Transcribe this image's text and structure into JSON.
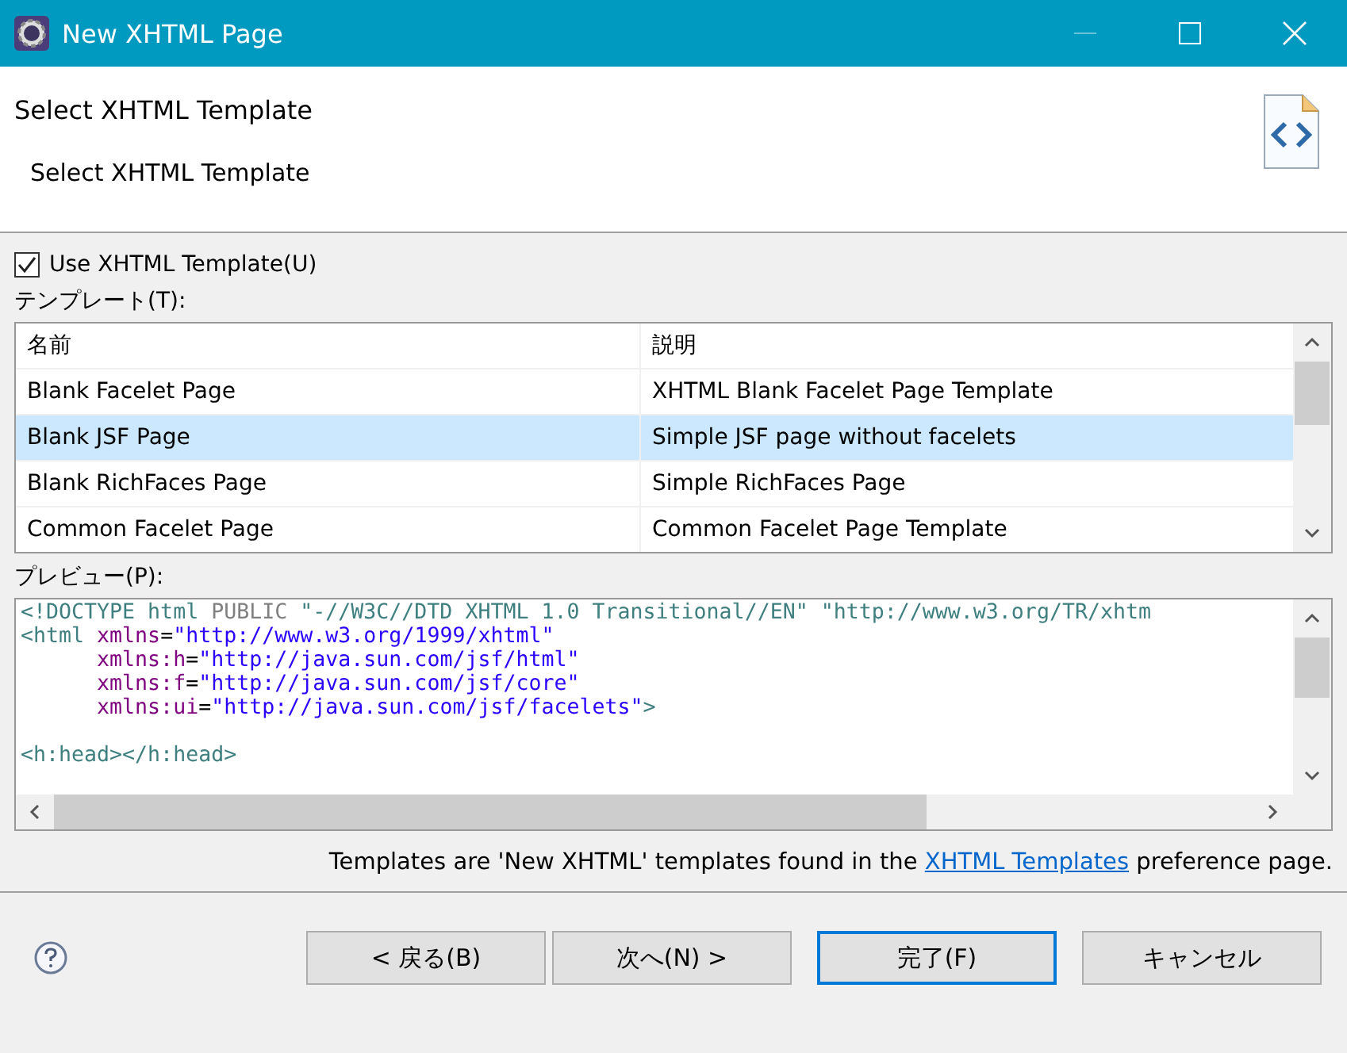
{
  "window": {
    "title": "New XHTML Page",
    "minimize_disabled": true
  },
  "header": {
    "title": "Select XHTML Template",
    "description": "Select XHTML Template"
  },
  "use_template": {
    "label": "Use XHTML Template(U)",
    "checked": true
  },
  "templates": {
    "label": "テンプレート(T):",
    "columns": [
      "名前",
      "説明"
    ],
    "rows": [
      {
        "name": "Blank Facelet Page",
        "description": "XHTML Blank Facelet Page Template",
        "selected": false
      },
      {
        "name": "Blank JSF Page",
        "description": "Simple JSF page without facelets",
        "selected": true
      },
      {
        "name": "Blank RichFaces Page",
        "description": "Simple RichFaces Page",
        "selected": false
      },
      {
        "name": "Common Facelet Page",
        "description": "Common Facelet Page Template",
        "selected": false
      }
    ]
  },
  "preview": {
    "label": "プレビュー(P):",
    "lines": [
      [
        {
          "kind": "tag",
          "text": "<!DOCTYPE html"
        },
        {
          "kind": "keyword",
          "text": " PUBLIC "
        },
        {
          "kind": "tag",
          "text": "\"-//W3C//DTD XHTML 1.0 Transitional//EN\" \"http://www.w3.org/TR/xhtm"
        }
      ],
      [
        {
          "kind": "tag",
          "text": "<html"
        },
        {
          "kind": "attr",
          "text": " xmlns"
        },
        {
          "kind": "plain",
          "text": "="
        },
        {
          "kind": "value",
          "text": "\"http://www.w3.org/1999/xhtml\""
        }
      ],
      [
        {
          "kind": "attr",
          "text": "      xmlns:h"
        },
        {
          "kind": "plain",
          "text": "="
        },
        {
          "kind": "value",
          "text": "\"http://java.sun.com/jsf/html\""
        }
      ],
      [
        {
          "kind": "attr",
          "text": "      xmlns:f"
        },
        {
          "kind": "plain",
          "text": "="
        },
        {
          "kind": "value",
          "text": "\"http://java.sun.com/jsf/core\""
        }
      ],
      [
        {
          "kind": "attr",
          "text": "      xmlns:ui"
        },
        {
          "kind": "plain",
          "text": "="
        },
        {
          "kind": "value",
          "text": "\"http://java.sun.com/jsf/facelets\""
        },
        {
          "kind": "tag",
          "text": ">"
        }
      ],
      {
        "blank_before": true,
        "tokens": [
          {
            "kind": "tag",
            "text": "<h:head></h:head>"
          }
        ]
      }
    ]
  },
  "note": {
    "before": "Templates are 'New XHTML' templates found in the ",
    "link": "XHTML Templates",
    "after": " preference page."
  },
  "buttons": [
    {
      "label": "< 戻る(B)",
      "default": false
    },
    {
      "label": "次へ(N) >",
      "default": false
    },
    {
      "label": "完了(F)",
      "default": true
    },
    {
      "label": "キャンセル",
      "default": false
    }
  ]
}
